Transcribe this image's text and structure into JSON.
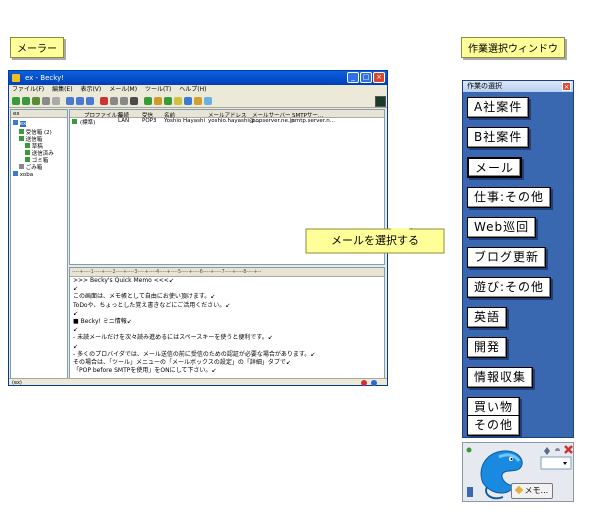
{
  "labels": {
    "mailer": "メーラー",
    "task_window": "作業選択ウィンドウ"
  },
  "becky": {
    "title": "ex - Becky!",
    "menu": [
      "ファイル(F)",
      "編集(E)",
      "表示(V)",
      "メール(M)",
      "ツール(T)",
      "ヘルプ(H)"
    ],
    "folder_header": "ex",
    "folders": [
      {
        "label": "ex",
        "depth": 0
      },
      {
        "label": "受信箱 (2)",
        "depth": 1
      },
      {
        "label": "送信箱",
        "depth": 1
      },
      {
        "label": "草稿",
        "depth": 2
      },
      {
        "label": "送信済み",
        "depth": 2
      },
      {
        "label": "ゴミ箱",
        "depth": 2
      },
      {
        "label": "ごみ箱",
        "depth": 1
      },
      {
        "label": "xoba",
        "depth": 0
      }
    ],
    "list_headers": [
      "プロファイル名",
      "接続",
      "受信",
      "名前",
      "メールアドレス",
      "メールサーバー",
      "SMTPサー..."
    ],
    "list_row": [
      "(標準)",
      "LAN",
      "POP3",
      "Yoshio Hayashi",
      "yoshio.hayashi@...",
      "popserver.ne.jp",
      "smtp.server.n..."
    ],
    "ruler": "----+----1----+----2----+----3----+----4----+----5----+----6----+----7----+----8----+--",
    "memo_lines": [
      ">>> Becky's Quick Memo <<<↙",
      "↙",
      "この画面は、メモ帳として自由にお使い頂けます。↙",
      "ToDoや、ちょっとした覚え書きなどにご活用ください。↙",
      "↙",
      "■ Becky! ミニ情報↙",
      "↙",
      "- 未読メールだけを次々読み進めるにはスペースキーを使うと便利です。↙",
      "↙",
      "- 多くのプロバイダでは、メール送信の前に受信のための認証が必要な場合があります。↙",
      "  その場合は、「ツール」メニューの「メールボックスの設定」の「詳細」タブで↙",
      "  「POP before SMTPを使用」をONにして下さい。↙"
    ],
    "status": "(ex)"
  },
  "task": {
    "title": "作業の選択",
    "buttons": [
      "A社案件",
      "B社案件",
      "メール",
      "仕事:その他",
      "Web巡回",
      "ブログ更新",
      "遊び:その他",
      "英語",
      "開発",
      "情報収集",
      "買い物",
      "その他"
    ]
  },
  "mascot": {
    "memo_button": "メモ..."
  },
  "callout": {
    "text": "メールを選択する"
  },
  "colors": {
    "label_bg": "#ffff99",
    "task_bg": "#3a68b0",
    "titlebar": "#0a5fe0"
  }
}
